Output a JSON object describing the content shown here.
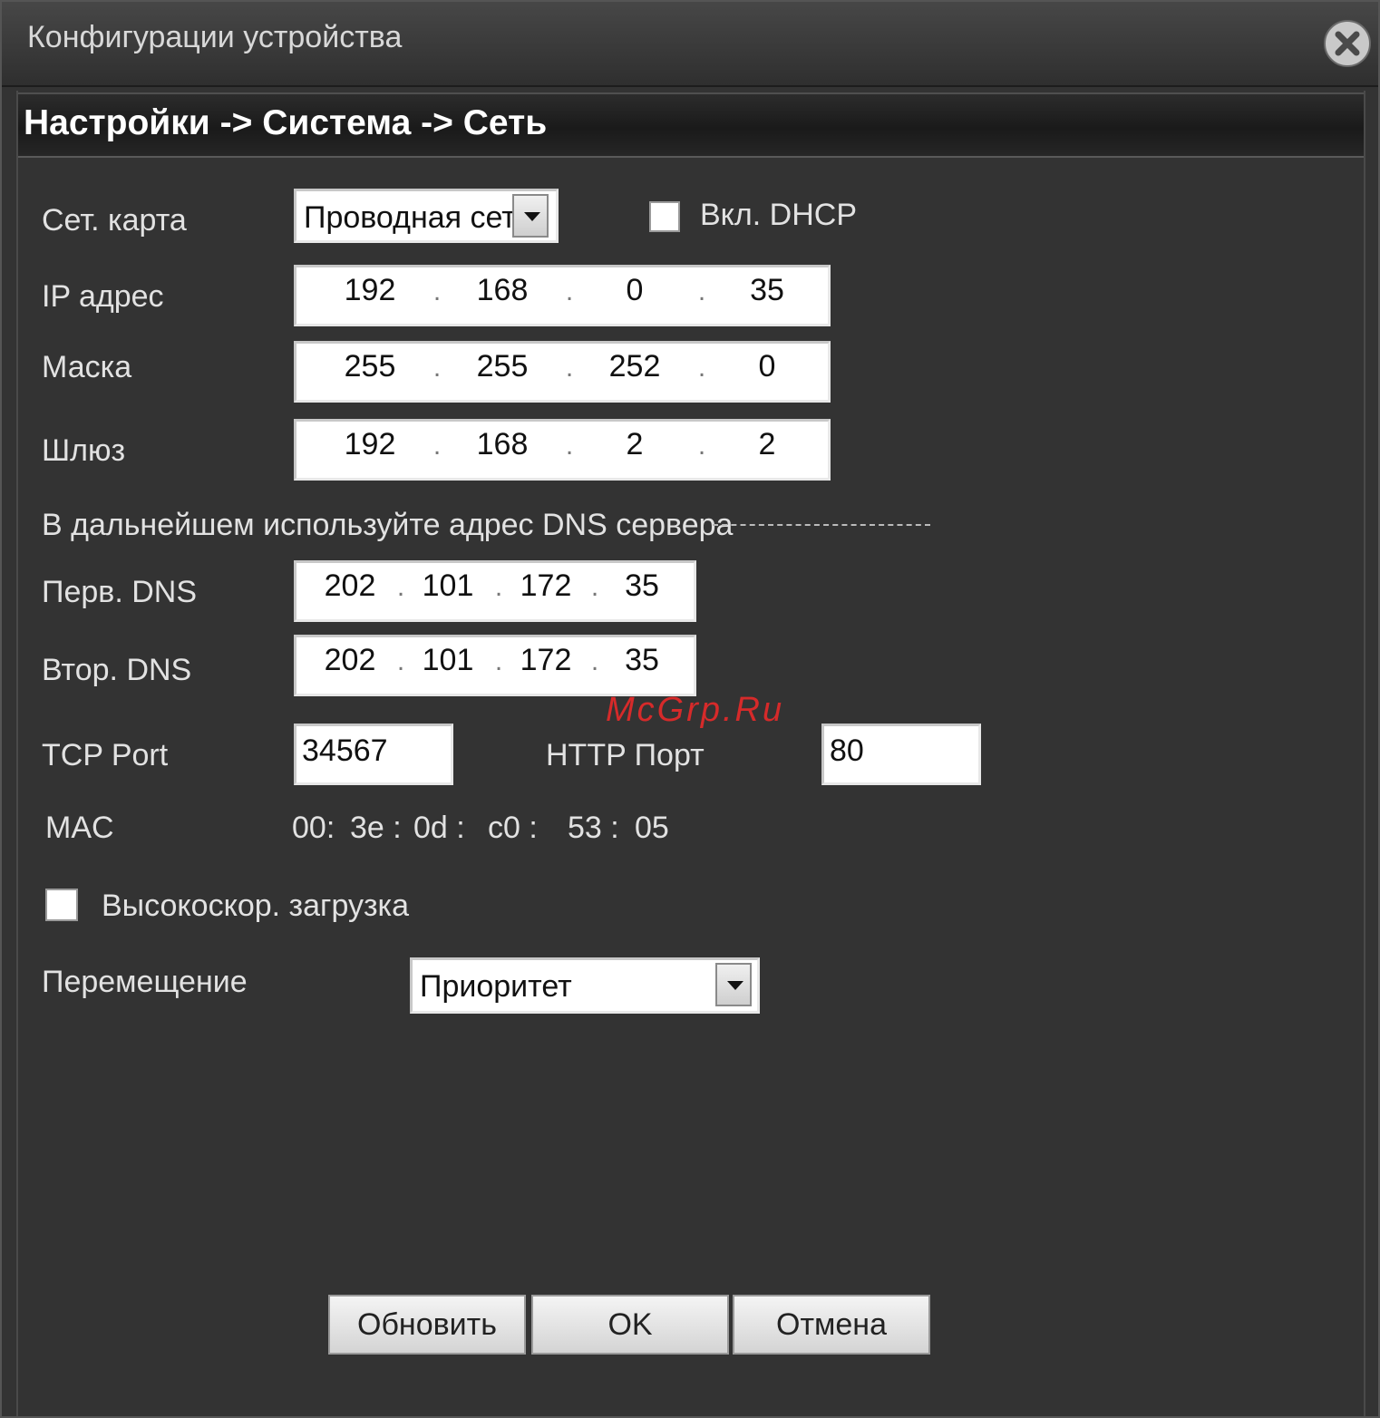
{
  "window": {
    "title": "Конфигурации устройства"
  },
  "breadcrumb": "Настройки -> Система -> Сеть",
  "form": {
    "net_card_label": "Сет. карта",
    "net_card_value": "Проводная сет",
    "dhcp_label": "Вкл. DHCP",
    "dhcp_checked": false,
    "ip_label": "IP адрес",
    "ip": [
      "192",
      "168",
      "0",
      "35"
    ],
    "mask_label": "Маска",
    "mask": [
      "255",
      "255",
      "252",
      "0"
    ],
    "gateway_label": "Шлюз",
    "gateway": [
      "192",
      "168",
      "2",
      "2"
    ],
    "dns_section_label": "В дальнейшем используйте адрес DNS сервера",
    "dns1_label": "Перв. DNS",
    "dns1": [
      "202",
      "101",
      "172",
      "35"
    ],
    "dns2_label": "Втор. DNS",
    "dns2": [
      "202",
      "101",
      "172",
      "35"
    ],
    "tcp_port_label": "TCP Port",
    "tcp_port": "34567",
    "http_port_label": "HTTP Порт",
    "http_port": "80",
    "mac_label": "MAC",
    "mac": [
      "00:",
      "3e :",
      "0d :",
      "c0 :",
      "53 :",
      "05"
    ],
    "high_speed_label": "Высокоскор. загрузка",
    "high_speed_checked": false,
    "transfer_label": "Перемещение",
    "transfer_value": "Приоритет"
  },
  "buttons": {
    "refresh": "Обновить",
    "ok": "OK",
    "cancel": "Отмена"
  },
  "watermark": "McGrp.Ru",
  "colors": {
    "background": "#333333",
    "field": "#ffffff",
    "text": "#e2e2e2",
    "watermark": "#d62a2a"
  },
  "icons": {
    "close": "close-icon",
    "dropdown": "chevron-down-icon"
  }
}
